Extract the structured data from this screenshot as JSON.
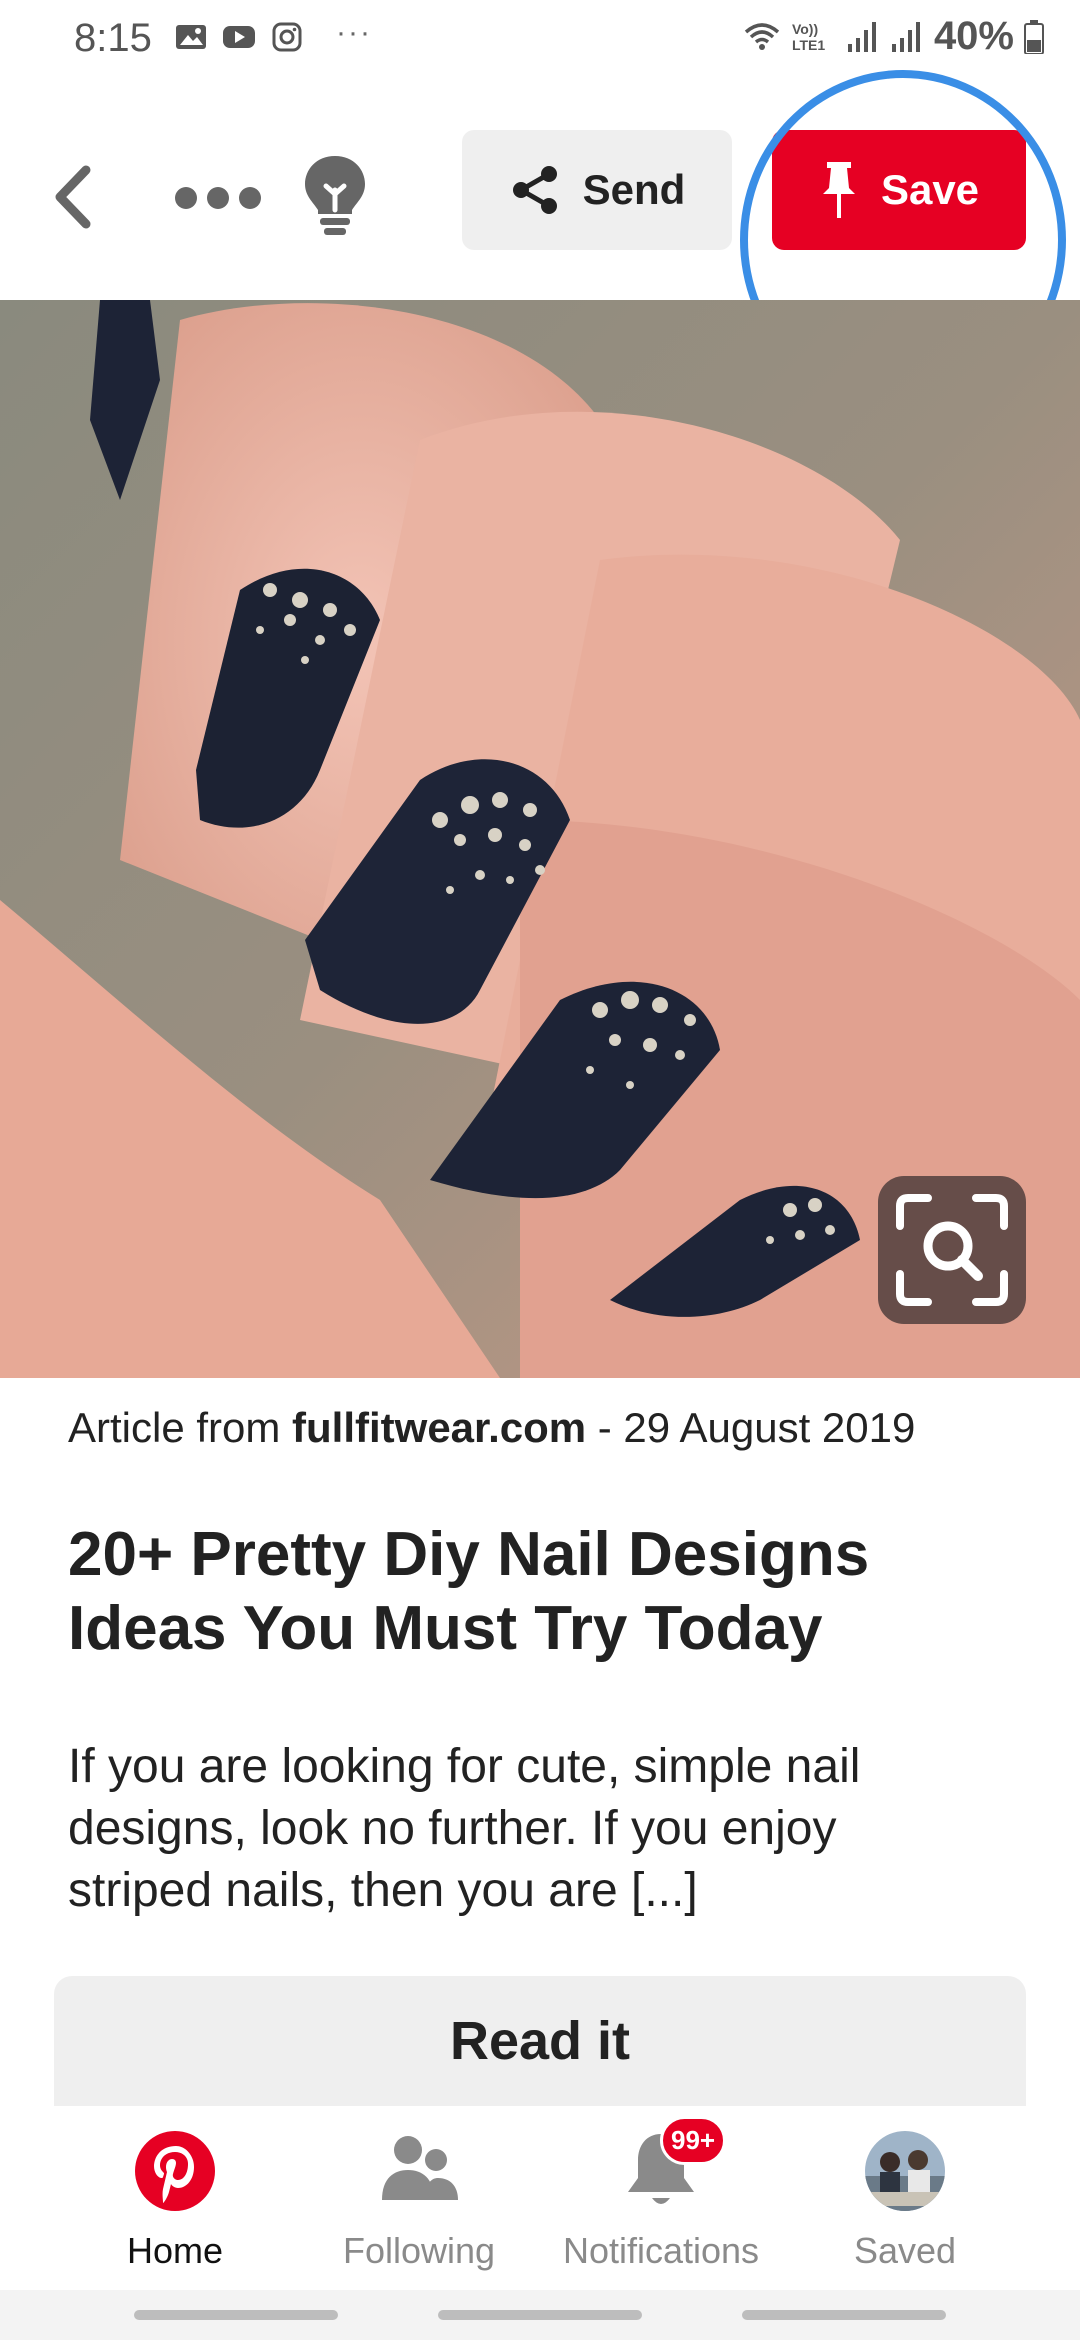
{
  "status_bar": {
    "time": "8:15",
    "battery": "40%",
    "more": "···",
    "network_label": "Vo)) LTE1"
  },
  "topbar": {
    "send_label": "Send",
    "save_label": "Save"
  },
  "article": {
    "source_prefix": "Article from ",
    "source_domain": "fullfitwear.com",
    "source_date": " - 29 August 2019",
    "title": "20+ Pretty Diy Nail Designs Ideas You Must Try Today",
    "description": "If you are looking for cute, simple nail designs, look no further. If you enjoy striped nails, then you are [...]",
    "read_button": "Read it"
  },
  "bottom_nav": {
    "items": [
      {
        "label": "Home",
        "icon": "pinterest-logo-icon"
      },
      {
        "label": "Following",
        "icon": "people-icon"
      },
      {
        "label": "Notifications",
        "icon": "bell-icon",
        "badge": "99+"
      },
      {
        "label": "Saved",
        "icon": "avatar"
      }
    ]
  },
  "colors": {
    "accent_red": "#e60023",
    "highlight_ring": "#3a8ee6",
    "button_grey": "#efefef"
  }
}
